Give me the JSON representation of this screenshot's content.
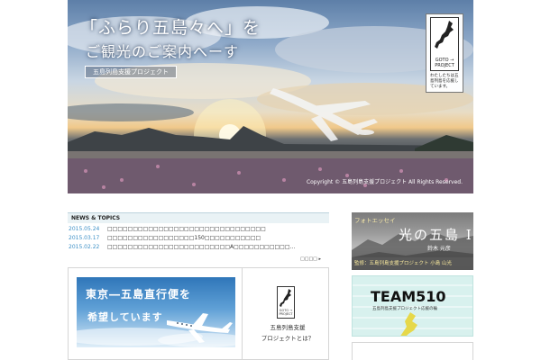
{
  "hero": {
    "title_line1": "「ふらり五島々へ」を",
    "title_line2": "ご観光のご案内へーす",
    "tag": "五島列島支援プロジェクト",
    "copyright": "Copyright © 五島列島支援プロジェクト All Rights Reserved.",
    "badge": {
      "label": "GOTO → PROJECT",
      "message": "わたしたちは五島列島を応援しています。"
    }
  },
  "news": {
    "heading": "NEWS & TOPICS",
    "items": [
      {
        "date": "2015.05.24",
        "text": "□□□□□□□□□□□□□□□□□□□□□□□□□□□□□□□"
      },
      {
        "date": "2015.03.17",
        "text": "□□□□□□□□□□□□□□□□□150□□□□□□□□□□□"
      },
      {
        "date": "2015.02.22",
        "text": "□□□□□□□□□□□□□□□□□□□□□□□□A□□□□□□□□□□□..."
      }
    ],
    "more": "□□□□ ▸"
  },
  "panels": {
    "tokyo_banner": {
      "line1": "東京―五島直行便を",
      "line2": "希望しています"
    },
    "project": {
      "logo_label": "GOTO → PROJECT",
      "line1": "五島列島支援",
      "line2": "プロジェクトとは？"
    }
  },
  "photo_essay": {
    "tag": "フォトエッセイ",
    "title": "光の五島 I",
    "author": "鈴木 元彦",
    "credit": "監修：五島列島支援プロジェクト 小島 山光"
  },
  "team510": {
    "title": "TEAM510",
    "subtitle": "五島列島支援プロジェクト応援の輪"
  }
}
